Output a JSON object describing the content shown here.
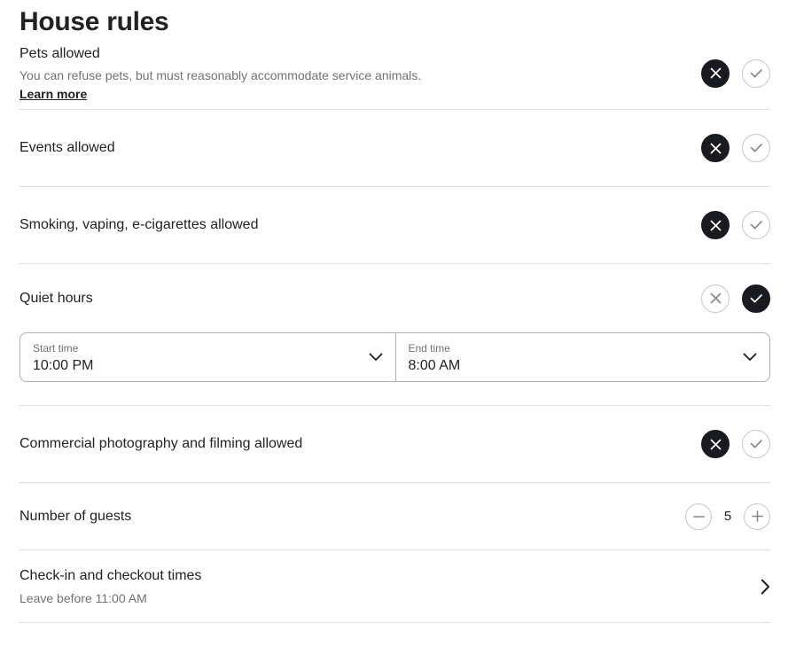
{
  "header": {
    "title": "House rules"
  },
  "icons": {
    "x": "x-icon",
    "check": "check-icon",
    "minus": "minus-icon",
    "plus": "plus-icon",
    "chevron_down": "chevron-down-icon",
    "chevron_right": "chevron-right-icon"
  },
  "colors": {
    "selected_fill": "#1a1b20",
    "divider": "#dddddd",
    "muted_text": "#717171",
    "primary_text": "#222222",
    "field_border": "#b0b0b0",
    "circle_border": "#c7c7c7"
  },
  "rules": [
    {
      "id": "pets-allowed",
      "label": "Pets allowed",
      "description": "You can refuse pets, but must reasonably accommodate service animals.",
      "link_label": "Learn more",
      "selected": "no"
    },
    {
      "id": "events-allowed",
      "label": "Events allowed",
      "selected": "no"
    },
    {
      "id": "smoking-allowed",
      "label": "Smoking, vaping, e-cigarettes allowed",
      "selected": "no"
    },
    {
      "id": "quiet-hours",
      "label": "Quiet hours",
      "selected": "yes"
    },
    {
      "id": "commercial-photography-allowed",
      "label": "Commercial photography and filming allowed",
      "selected": "no"
    }
  ],
  "quiet_hours": {
    "start": {
      "label": "Start time",
      "value": "10:00 PM"
    },
    "end": {
      "label": "End time",
      "value": "8:00 AM"
    }
  },
  "guests": {
    "label": "Number of guests",
    "value": "5",
    "decrease_label": "−",
    "increase_label": "+"
  },
  "checkin": {
    "label": "Check-in and checkout times",
    "sub": "Leave before 11:00 AM"
  }
}
